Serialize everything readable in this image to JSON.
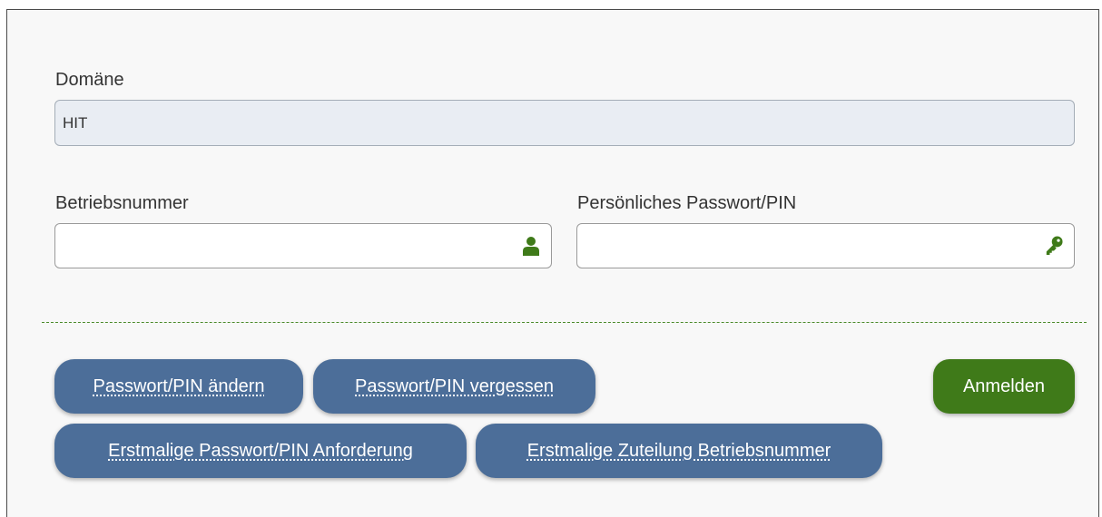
{
  "form": {
    "domain": {
      "label": "Domäne",
      "value": "HIT"
    },
    "operation_number": {
      "label": "Betriebsnummer",
      "value": "",
      "icon": "user-icon"
    },
    "password": {
      "label": "Persönliches Passwort/PIN",
      "value": "",
      "icon": "key-icon"
    }
  },
  "buttons": {
    "change_pin": "Passwort/PIN ändern",
    "forgot_pin": "Passwort/PIN vergessen",
    "request_pin": "Erstmalige Passwort/PIN Anforderung",
    "assign_number": "Erstmalige Zuteilung Betriebsnummer",
    "login": "Anmelden"
  },
  "colors": {
    "primary_button": "#3f7a19",
    "secondary_button": "#4c6e99",
    "icon_green": "#3f7a19",
    "divider": "#4a8a2a"
  }
}
